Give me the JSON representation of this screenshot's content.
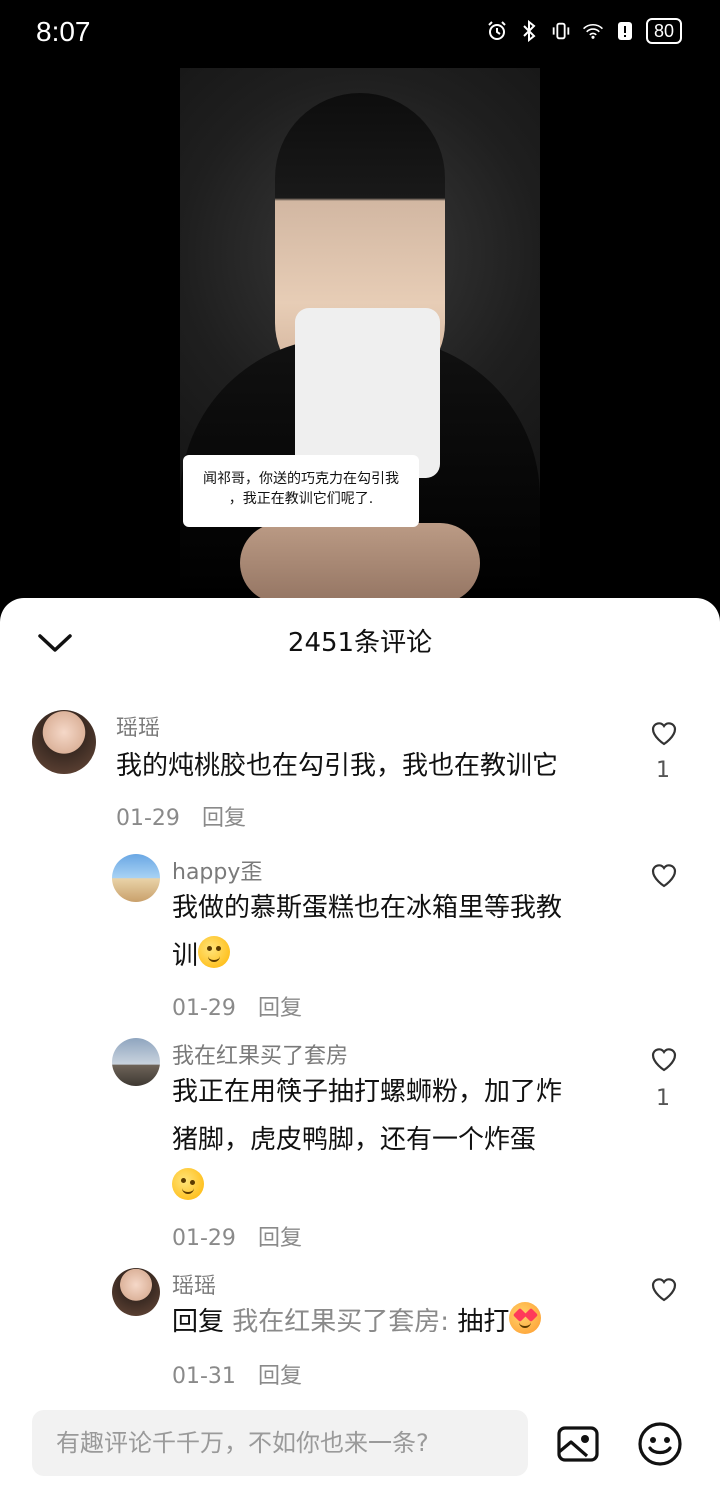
{
  "status_bar": {
    "time": "8:07",
    "battery": "80"
  },
  "video": {
    "caption_line1": "闻祁哥，你送的巧克力在勾引我",
    "caption_line2": "，我正在教训它们呢了."
  },
  "comments_panel": {
    "title": "2451条评论",
    "comments": [
      {
        "name": "瑶瑶",
        "text_line1": "我的炖桃胶也在勾引我，我也在教训它",
        "date": "01-29",
        "reply_label": "回复",
        "likes": "1"
      },
      {
        "name": "happy歪",
        "text_line1": "我做的慕斯蛋糕也在冰箱里等我教",
        "text_line2": "训",
        "date": "01-29",
        "reply_label": "回复",
        "likes": ""
      },
      {
        "name": "我在红果买了套房",
        "text_line1": "我正在用筷子抽打螺蛳粉，加了炸",
        "text_line2": "猪脚，虎皮鸭脚，还有一个炸蛋",
        "date": "01-29",
        "reply_label": "回复",
        "likes": "1"
      },
      {
        "name": "瑶瑶",
        "reply_prefix": "回复",
        "reply_to": "我在红果买了套房:",
        "text": "抽打",
        "date": "01-31",
        "reply_label": "回复",
        "likes": ""
      }
    ]
  },
  "input_bar": {
    "placeholder": "有趣评论千千万，不如你也来一条?"
  },
  "icons": {
    "collapse": "chevron-down-icon",
    "like": "heart-outline-icon",
    "image": "image-icon",
    "emoji": "smile-icon"
  }
}
